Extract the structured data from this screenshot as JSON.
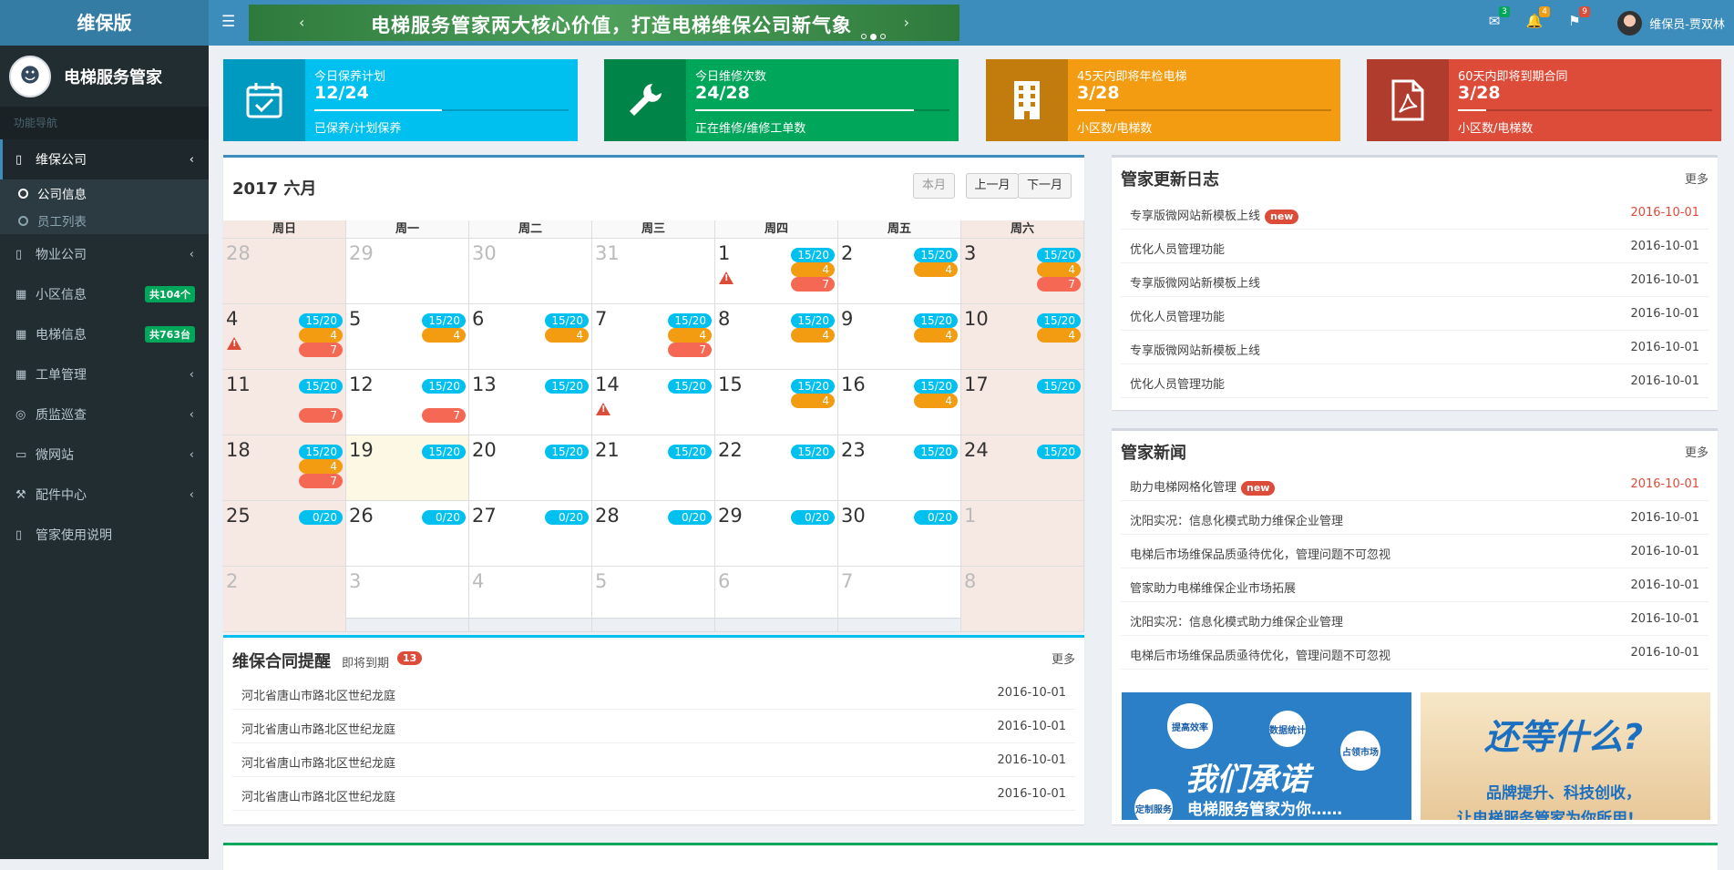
{
  "header": {
    "logo": "维保版",
    "banner_text": "电梯服务管家两大核心价值，打造电梯维保公司新气象",
    "messages_count": "3",
    "alerts_count": "4",
    "flags_count": "9",
    "user": "维保员-贾双林"
  },
  "sidebar": {
    "company_name": "电梯服务管家",
    "nav_header": "功能导航",
    "items": [
      {
        "label": "维保公司",
        "icon": "book-icon"
      },
      {
        "label": "物业公司",
        "icon": "book-icon"
      },
      {
        "label": "小区信息",
        "icon": "grid-icon",
        "badge": "共104个"
      },
      {
        "label": "电梯信息",
        "icon": "grid-icon",
        "badge": "共763台"
      },
      {
        "label": "工单管理",
        "icon": "table-icon"
      },
      {
        "label": "质监巡查",
        "icon": "lifebuoy-icon"
      },
      {
        "label": "微网站",
        "icon": "desktop-icon"
      },
      {
        "label": "配件中心",
        "icon": "wrench-icon"
      },
      {
        "label": "管家使用说明",
        "icon": "book-icon"
      }
    ],
    "subitems": [
      {
        "label": "公司信息"
      },
      {
        "label": "员工列表"
      }
    ]
  },
  "stats": [
    {
      "title": "今日保养计划",
      "value": "12/24",
      "desc": "已保养/计划保养",
      "color": "#00c0ef",
      "progress": 0.5
    },
    {
      "title": "今日维修次数",
      "value": "24/28",
      "desc": "正在维修/维修工单数",
      "color": "#00a65a",
      "progress": 0.86
    },
    {
      "title": "45天内即将年检电梯",
      "value": "3/28",
      "desc": "小区数/电梯数",
      "color": "#f39c12",
      "progress": 0.11
    },
    {
      "title": "60天内即将到期合同",
      "value": "3/28",
      "desc": "小区数/电梯数",
      "color": "#dd4b39",
      "progress": 0.11
    }
  ],
  "calendar": {
    "title": "2017 六月",
    "btn_month": "本月",
    "btn_prev": "上一月",
    "btn_next": "下一月",
    "weekdays": [
      "周日",
      "周一",
      "周二",
      "周三",
      "周四",
      "周五",
      "周六"
    ],
    "weeks": [
      [
        {
          "d": "28",
          "o": 1
        },
        {
          "d": "29",
          "o": 1
        },
        {
          "d": "30",
          "o": 1
        },
        {
          "d": "31",
          "o": 1
        },
        {
          "d": "1",
          "ev": [
            "15/20",
            "4",
            "7"
          ],
          "w": 1
        },
        {
          "d": "2",
          "ev": [
            "15/20",
            "4"
          ]
        },
        {
          "d": "3",
          "ev": [
            "15/20",
            "4",
            "7"
          ]
        }
      ],
      [
        {
          "d": "4",
          "ev": [
            "15/20",
            "4",
            "7"
          ],
          "w": 1
        },
        {
          "d": "5",
          "ev": [
            "15/20",
            "4"
          ]
        },
        {
          "d": "6",
          "ev": [
            "15/20",
            "4"
          ]
        },
        {
          "d": "7",
          "ev": [
            "15/20",
            "4",
            "7"
          ]
        },
        {
          "d": "8",
          "ev": [
            "15/20",
            "4"
          ]
        },
        {
          "d": "9",
          "ev": [
            "15/20",
            "4"
          ]
        },
        {
          "d": "10",
          "ev": [
            "15/20",
            "4"
          ]
        }
      ],
      [
        {
          "d": "11",
          "ev": [
            "15/20",
            null,
            "7"
          ]
        },
        {
          "d": "12",
          "ev": [
            "15/20",
            null,
            "7"
          ]
        },
        {
          "d": "13",
          "ev": [
            "15/20"
          ]
        },
        {
          "d": "14",
          "ev": [
            "15/20"
          ],
          "w": 1
        },
        {
          "d": "15",
          "ev": [
            "15/20",
            "4"
          ]
        },
        {
          "d": "16",
          "ev": [
            "15/20",
            "4"
          ]
        },
        {
          "d": "17",
          "ev": [
            "15/20"
          ]
        }
      ],
      [
        {
          "d": "18",
          "ev": [
            "15/20",
            "4",
            "7"
          ]
        },
        {
          "d": "19",
          "ev": [
            "15/20"
          ],
          "t": 1
        },
        {
          "d": "20",
          "ev": [
            "15/20"
          ]
        },
        {
          "d": "21",
          "ev": [
            "15/20"
          ]
        },
        {
          "d": "22",
          "ev": [
            "15/20"
          ]
        },
        {
          "d": "23",
          "ev": [
            "15/20"
          ]
        },
        {
          "d": "24",
          "ev": [
            "15/20"
          ]
        }
      ],
      [
        {
          "d": "25",
          "ev": [
            "0/20"
          ]
        },
        {
          "d": "26",
          "ev": [
            "0/20"
          ]
        },
        {
          "d": "27",
          "ev": [
            "0/20"
          ]
        },
        {
          "d": "28",
          "ev": [
            "0/20"
          ]
        },
        {
          "d": "29",
          "ev": [
            "0/20"
          ]
        },
        {
          "d": "30",
          "ev": [
            "0/20"
          ]
        },
        {
          "d": "1",
          "o": 1
        }
      ],
      [
        {
          "d": "2",
          "o": 1
        },
        {
          "d": "3",
          "o": 1
        },
        {
          "d": "4",
          "o": 1
        },
        {
          "d": "5",
          "o": 1
        },
        {
          "d": "6",
          "o": 1
        },
        {
          "d": "7",
          "o": 1
        },
        {
          "d": "8",
          "o": 1
        }
      ]
    ]
  },
  "contracts": {
    "title": "维保合同提醒",
    "subtitle": "即将到期",
    "count": "13",
    "more": "更多",
    "items": [
      {
        "text": "河北省唐山市路北区世纪龙庭",
        "date": "2016-10-01"
      },
      {
        "text": "河北省唐山市路北区世纪龙庭",
        "date": "2016-10-01"
      },
      {
        "text": "河北省唐山市路北区世纪龙庭",
        "date": "2016-10-01"
      },
      {
        "text": "河北省唐山市路北区世纪龙庭",
        "date": "2016-10-01"
      }
    ]
  },
  "updates": {
    "title": "管家更新日志",
    "more": "更多",
    "items": [
      {
        "text": "专享版微网站新模板上线",
        "date": "2016-10-01",
        "new": "new"
      },
      {
        "text": "优化人员管理功能",
        "date": "2016-10-01"
      },
      {
        "text": "专享版微网站新模板上线",
        "date": "2016-10-01"
      },
      {
        "text": "优化人员管理功能",
        "date": "2016-10-01"
      },
      {
        "text": "专享版微网站新模板上线",
        "date": "2016-10-01"
      },
      {
        "text": "优化人员管理功能",
        "date": "2016-10-01"
      }
    ]
  },
  "news": {
    "title": "管家新闻",
    "more": "更多",
    "items": [
      {
        "text": "助力电梯网格化管理",
        "date": "2016-10-01",
        "new": "new"
      },
      {
        "text": "沈阳实况：信息化模式助力维保企业管理",
        "date": "2016-10-01"
      },
      {
        "text": "电梯后市场维保品质亟待优化，管理问题不可忽视",
        "date": "2016-10-01"
      },
      {
        "text": "管家助力电梯维保企业市场拓展",
        "date": "2016-10-01"
      },
      {
        "text": "沈阳实况：信息化模式助力维保企业管理",
        "date": "2016-10-01"
      },
      {
        "text": "电梯后市场维保品质亟待优化，管理问题不可忽视",
        "date": "2016-10-01"
      }
    ]
  },
  "ads": {
    "ad1_title": "我们承诺",
    "ad1_sub": "电梯服务管家为你……",
    "ad1_bubbles": [
      "提高效率",
      "数据统计",
      "占领市场",
      "定制服务"
    ],
    "ad2_title": "还等什么?",
    "ad2_sub": "品牌提升、科技创收，",
    "ad2_sub2": "让电梯服务管家为你所用!"
  }
}
